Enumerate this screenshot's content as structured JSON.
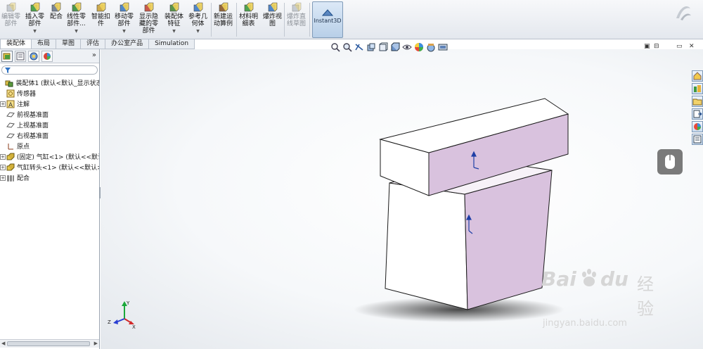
{
  "ribbon": {
    "buttons": [
      {
        "label": "编辑零\n部件",
        "icon": "edit-component-icon",
        "disabled": true,
        "dropdown": false
      },
      {
        "label": "插入零\n部件",
        "icon": "insert-component-icon",
        "disabled": false,
        "dropdown": true
      },
      {
        "label": "配合",
        "icon": "mate-icon",
        "disabled": false,
        "dropdown": false
      },
      {
        "label": "线性零\n部件...",
        "icon": "linear-pattern-icon",
        "disabled": false,
        "dropdown": true
      },
      {
        "label": "智能扣\n件",
        "icon": "smart-fasteners-icon",
        "disabled": false,
        "dropdown": false
      },
      {
        "label": "移动零\n部件",
        "icon": "move-component-icon",
        "disabled": false,
        "dropdown": true
      },
      {
        "label": "显示隐\n藏的零\n部件",
        "icon": "show-hidden-icon",
        "disabled": false,
        "dropdown": false
      },
      {
        "label": "装配体\n特征",
        "icon": "assembly-features-icon",
        "disabled": false,
        "dropdown": true
      },
      {
        "label": "参考几\n何体",
        "icon": "reference-geometry-icon",
        "disabled": false,
        "dropdown": true
      },
      {
        "label": "新建运\n动算例",
        "icon": "new-motion-study-icon",
        "disabled": false,
        "dropdown": false
      },
      {
        "label": "材料明\n细表",
        "icon": "bill-of-materials-icon",
        "disabled": false,
        "dropdown": false
      },
      {
        "label": "爆炸视\n图",
        "icon": "exploded-view-icon",
        "disabled": false,
        "dropdown": false
      },
      {
        "label": "爆炸直\n线草图",
        "icon": "explode-line-sketch-icon",
        "disabled": true,
        "dropdown": false
      }
    ],
    "instant3d": "Instant3D"
  },
  "command_tabs": [
    "装配体",
    "布局",
    "草图",
    "评估",
    "办公室产品",
    "Simulation"
  ],
  "active_tab": 0,
  "panel": {
    "expand_glyph": "»",
    "tree": [
      {
        "label": "装配体1  (默认<默认_显示状态-1>)",
        "icon": "assembly-icon",
        "expander": false
      },
      {
        "label": "传感器",
        "icon": "sensor-icon",
        "expander": false
      },
      {
        "label": "注解",
        "icon": "annotation-icon",
        "expander": true
      },
      {
        "label": "前视基准面",
        "icon": "plane-icon",
        "expander": false
      },
      {
        "label": "上视基准面",
        "icon": "plane-icon",
        "expander": false
      },
      {
        "label": "右视基准面",
        "icon": "plane-icon",
        "expander": false
      },
      {
        "label": "原点",
        "icon": "origin-icon",
        "expander": false
      },
      {
        "label": "(固定) 气缸<1> (默认<<默认>",
        "icon": "part-icon",
        "expander": true
      },
      {
        "label": "气缸转头<1> (默认<<默认>_显",
        "icon": "part-icon",
        "expander": true
      },
      {
        "label": "配合",
        "icon": "mates-folder-icon",
        "expander": true
      }
    ]
  },
  "viewport": {
    "window_controls": [
      "▣",
      "⊟",
      "▭",
      "✕"
    ],
    "triad_labels": {
      "y": "Y",
      "z": "Z",
      "x": "X"
    }
  },
  "watermark": {
    "brand": "Bai",
    "brand2": "du",
    "cn": "经验",
    "url": "jingyan.baidu.com"
  },
  "colors": {
    "face_side": "#d9c2de",
    "face_front": "#ffffff",
    "accent": "#1f3fa6"
  }
}
